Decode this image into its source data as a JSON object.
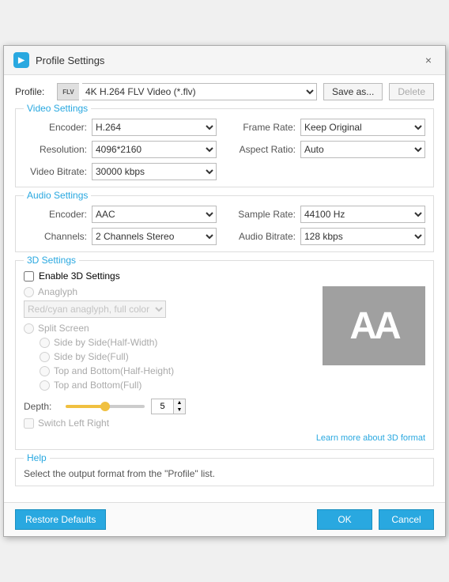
{
  "titleBar": {
    "appIcon": "V",
    "title": "Profile Settings",
    "closeLabel": "×"
  },
  "profileRow": {
    "label": "Profile:",
    "iconText": "FLV",
    "selectedProfile": "4K H.264 FLV Video (*.flv)",
    "saveAsLabel": "Save as...",
    "deleteLabel": "Delete"
  },
  "videoSettings": {
    "sectionTitle": "Video Settings",
    "encoderLabel": "Encoder:",
    "encoderValue": "H.264",
    "resolutionLabel": "Resolution:",
    "resolutionValue": "4096*2160",
    "videoBitrateLabel": "Video Bitrate:",
    "videoBitrateValue": "30000 kbps",
    "frameRateLabel": "Frame Rate:",
    "frameRateValue": "Keep Original",
    "aspectRatioLabel": "Aspect Ratio:",
    "aspectRatioValue": "Auto"
  },
  "audioSettings": {
    "sectionTitle": "Audio Settings",
    "encoderLabel": "Encoder:",
    "encoderValue": "AAC",
    "channelsLabel": "Channels:",
    "channelsValue": "2 Channels Stereo",
    "sampleRateLabel": "Sample Rate:",
    "sampleRateValue": "44100 Hz",
    "audioBitrateLabel": "Audio Bitrate:",
    "audioBitrateValue": "128 kbps"
  },
  "threeDSettings": {
    "sectionTitle": "3D Settings",
    "enableLabel": "Enable 3D Settings",
    "anaglyphLabel": "Anaglyph",
    "anaglyphSelectValue": "Red/cyan anaglyph, full color",
    "splitScreenLabel": "Split Screen",
    "splitOptions": [
      "Side by Side(Half-Width)",
      "Side by Side(Full)",
      "Top and Bottom(Half-Height)",
      "Top and Bottom(Full)"
    ],
    "depthLabel": "Depth:",
    "depthValue": "5",
    "switchLabel": "Switch Left Right",
    "learnMoreLabel": "Learn more about 3D format",
    "previewText": "AA"
  },
  "help": {
    "sectionTitle": "Help",
    "helpText": "Select the output format from the \"Profile\" list."
  },
  "bottomBar": {
    "restoreLabel": "Restore Defaults",
    "okLabel": "OK",
    "cancelLabel": "Cancel"
  }
}
